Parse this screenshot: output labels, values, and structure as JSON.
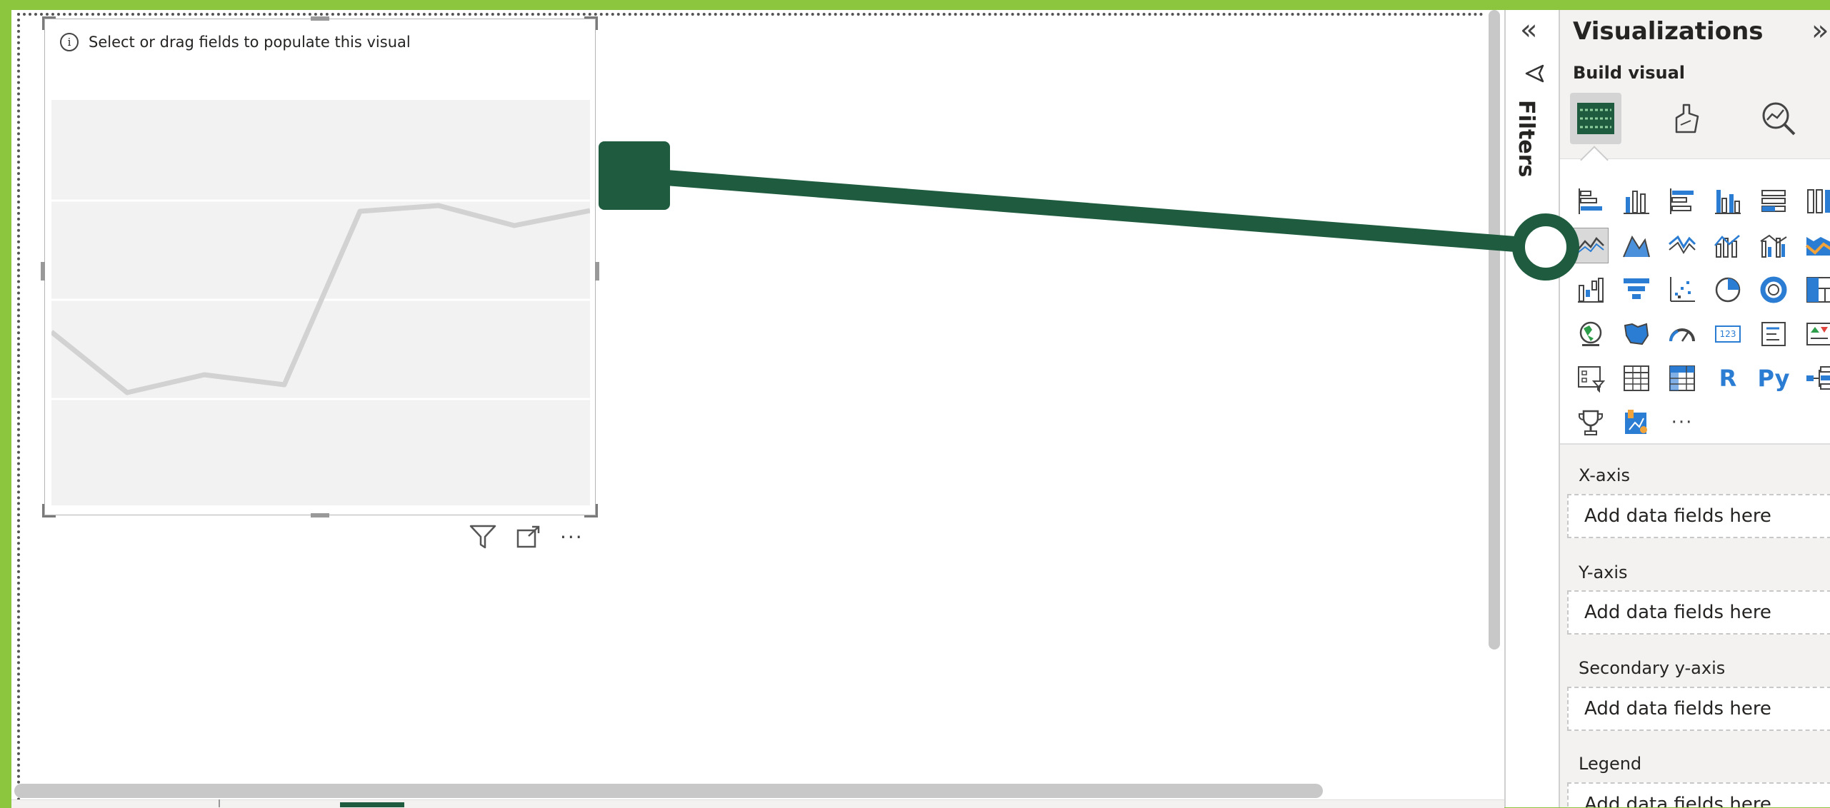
{
  "canvas": {
    "visual": {
      "empty_message": "Select or drag fields to populate this visual",
      "header_icons": [
        "filter-icon",
        "focus-mode-icon",
        "more-options-icon"
      ],
      "more_options_glyph": "···"
    }
  },
  "filters_pane": {
    "collapse_glyph": "«",
    "label": "Filters"
  },
  "visualizations_pane": {
    "title": "Visualizations",
    "expand_glyph": "»",
    "build_visual_label": "Build visual",
    "mode_tabs": [
      "build-visual-tab",
      "format-visual-tab",
      "analytics-tab"
    ],
    "gallery_more_glyph": "···",
    "gallery_text_icons": {
      "r": "R",
      "py": "Py",
      "card": "123"
    },
    "selected_visual": "line-chart",
    "wells": [
      {
        "label": "X-axis",
        "placeholder": "Add data fields here"
      },
      {
        "label": "Y-axis",
        "placeholder": "Add data fields here"
      },
      {
        "label": "Secondary y-axis",
        "placeholder": "Add data fields here"
      },
      {
        "label": "Legend",
        "placeholder": "Add data fields here"
      }
    ]
  },
  "colors": {
    "accent_green": "#1f5c3f",
    "outer_border": "#8cc63f",
    "icon_blue": "#2b7cd3"
  }
}
